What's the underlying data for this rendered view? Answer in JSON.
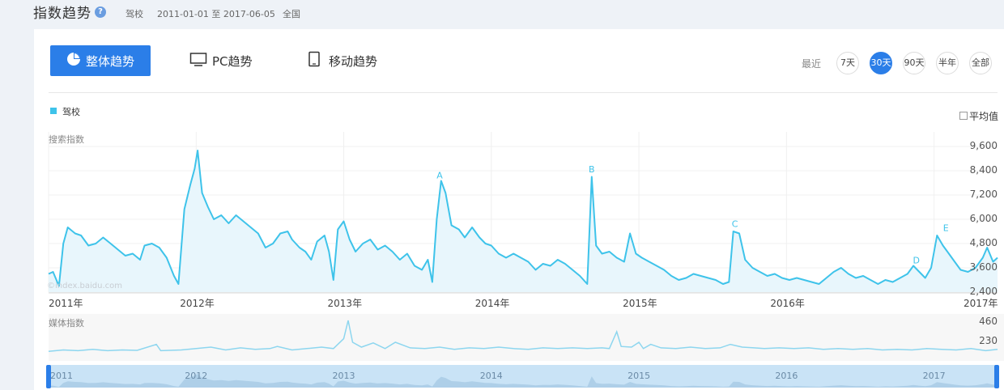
{
  "header": {
    "title": "指数趋势",
    "keyword": "驾校",
    "date_range": "2011-01-01 至 2017-06-05",
    "region": "全国"
  },
  "tabs": [
    {
      "label": "整体趋势",
      "icon": "pie-chart-icon",
      "active": true
    },
    {
      "label": "PC趋势",
      "icon": "monitor-icon",
      "active": false
    },
    {
      "label": "移动趋势",
      "icon": "tablet-icon",
      "active": false
    }
  ],
  "range": {
    "label": "最近",
    "options": [
      "7天",
      "30天",
      "90天",
      "半年",
      "全部"
    ],
    "selected": "30天"
  },
  "legend": {
    "series_name": "驾校",
    "color": "#3ec3ea"
  },
  "average_toggle": {
    "label": "平均值",
    "checked": false
  },
  "watermark": "©index.baidu.com",
  "colors": {
    "accent": "#2b7ee8",
    "series": "#3ec3ea",
    "media": "#8dd6ef"
  },
  "chart_data": [
    {
      "type": "area",
      "title": "搜索指数",
      "x_labels": [
        "2011年",
        "2012年",
        "2013年",
        "2014年",
        "2015年",
        "2016年",
        "2017年"
      ],
      "y_ticks": [
        "9,600",
        "8,400",
        "7,200",
        "6,000",
        "4,800",
        "3,600",
        "2,400"
      ],
      "ylim": [
        2400,
        9600
      ],
      "xlim": [
        2011.0,
        2017.43
      ],
      "annotations": [
        {
          "label": "A",
          "x": 2013.65,
          "y": 7900
        },
        {
          "label": "B",
          "x": 2014.68,
          "y": 8200
        },
        {
          "label": "C",
          "x": 2015.65,
          "y": 5500
        },
        {
          "label": "D",
          "x": 2016.88,
          "y": 3700
        },
        {
          "label": "E",
          "x": 2017.08,
          "y": 5300
        }
      ],
      "series": [
        {
          "name": "驾校",
          "points": [
            [
              2011.0,
              3300
            ],
            [
              2011.03,
              3400
            ],
            [
              2011.07,
              2700
            ],
            [
              2011.1,
              4800
            ],
            [
              2011.13,
              5600
            ],
            [
              2011.18,
              5300
            ],
            [
              2011.22,
              5200
            ],
            [
              2011.27,
              4700
            ],
            [
              2011.32,
              4800
            ],
            [
              2011.37,
              5100
            ],
            [
              2011.42,
              4800
            ],
            [
              2011.47,
              4500
            ],
            [
              2011.52,
              4200
            ],
            [
              2011.57,
              4300
            ],
            [
              2011.62,
              4000
            ],
            [
              2011.65,
              4700
            ],
            [
              2011.7,
              4800
            ],
            [
              2011.75,
              4600
            ],
            [
              2011.8,
              4100
            ],
            [
              2011.85,
              3200
            ],
            [
              2011.88,
              2800
            ],
            [
              2011.92,
              6500
            ],
            [
              2011.96,
              7700
            ],
            [
              2011.99,
              8500
            ],
            [
              2012.01,
              9400
            ],
            [
              2012.04,
              7300
            ],
            [
              2012.08,
              6600
            ],
            [
              2012.12,
              6000
            ],
            [
              2012.17,
              6200
            ],
            [
              2012.22,
              5800
            ],
            [
              2012.27,
              6200
            ],
            [
              2012.32,
              5900
            ],
            [
              2012.37,
              5600
            ],
            [
              2012.42,
              5300
            ],
            [
              2012.47,
              4600
            ],
            [
              2012.52,
              4800
            ],
            [
              2012.57,
              5300
            ],
            [
              2012.62,
              5400
            ],
            [
              2012.65,
              5000
            ],
            [
              2012.7,
              4600
            ],
            [
              2012.74,
              4400
            ],
            [
              2012.78,
              4000
            ],
            [
              2012.82,
              4900
            ],
            [
              2012.87,
              5200
            ],
            [
              2012.9,
              4400
            ],
            [
              2012.93,
              3000
            ],
            [
              2012.96,
              5500
            ],
            [
              2013.0,
              5900
            ],
            [
              2013.04,
              5000
            ],
            [
              2013.08,
              4400
            ],
            [
              2013.13,
              4800
            ],
            [
              2013.18,
              5000
            ],
            [
              2013.23,
              4500
            ],
            [
              2013.28,
              4700
            ],
            [
              2013.33,
              4400
            ],
            [
              2013.38,
              4000
            ],
            [
              2013.43,
              4300
            ],
            [
              2013.48,
              3700
            ],
            [
              2013.53,
              3500
            ],
            [
              2013.57,
              4000
            ],
            [
              2013.6,
              2900
            ],
            [
              2013.63,
              6000
            ],
            [
              2013.66,
              7900
            ],
            [
              2013.69,
              7300
            ],
            [
              2013.73,
              5700
            ],
            [
              2013.78,
              5500
            ],
            [
              2013.82,
              5100
            ],
            [
              2013.87,
              5600
            ],
            [
              2013.92,
              5100
            ],
            [
              2013.96,
              4800
            ],
            [
              2014.0,
              4700
            ],
            [
              2014.05,
              4300
            ],
            [
              2014.1,
              4100
            ],
            [
              2014.15,
              4300
            ],
            [
              2014.2,
              4100
            ],
            [
              2014.25,
              3900
            ],
            [
              2014.3,
              3500
            ],
            [
              2014.35,
              3800
            ],
            [
              2014.4,
              3700
            ],
            [
              2014.45,
              4000
            ],
            [
              2014.5,
              3800
            ],
            [
              2014.55,
              3500
            ],
            [
              2014.6,
              3200
            ],
            [
              2014.65,
              2800
            ],
            [
              2014.68,
              8100
            ],
            [
              2014.71,
              4700
            ],
            [
              2014.75,
              4300
            ],
            [
              2014.8,
              4400
            ],
            [
              2014.85,
              4100
            ],
            [
              2014.9,
              3900
            ],
            [
              2014.94,
              5300
            ],
            [
              2014.98,
              4300
            ],
            [
              2015.02,
              4100
            ],
            [
              2015.07,
              3900
            ],
            [
              2015.12,
              3700
            ],
            [
              2015.17,
              3500
            ],
            [
              2015.22,
              3200
            ],
            [
              2015.27,
              3000
            ],
            [
              2015.32,
              3100
            ],
            [
              2015.37,
              3300
            ],
            [
              2015.42,
              3200
            ],
            [
              2015.47,
              3100
            ],
            [
              2015.52,
              3000
            ],
            [
              2015.57,
              2800
            ],
            [
              2015.61,
              2900
            ],
            [
              2015.64,
              5400
            ],
            [
              2015.68,
              5300
            ],
            [
              2015.72,
              4000
            ],
            [
              2015.77,
              3600
            ],
            [
              2015.82,
              3400
            ],
            [
              2015.87,
              3200
            ],
            [
              2015.92,
              3300
            ],
            [
              2015.97,
              3100
            ],
            [
              2016.02,
              3000
            ],
            [
              2016.07,
              3100
            ],
            [
              2016.12,
              3000
            ],
            [
              2016.17,
              2900
            ],
            [
              2016.22,
              2800
            ],
            [
              2016.27,
              3100
            ],
            [
              2016.32,
              3400
            ],
            [
              2016.37,
              3600
            ],
            [
              2016.42,
              3300
            ],
            [
              2016.47,
              3100
            ],
            [
              2016.52,
              3200
            ],
            [
              2016.57,
              3000
            ],
            [
              2016.62,
              2800
            ],
            [
              2016.67,
              3000
            ],
            [
              2016.72,
              2900
            ],
            [
              2016.77,
              3100
            ],
            [
              2016.82,
              3300
            ],
            [
              2016.86,
              3700
            ],
            [
              2016.9,
              3400
            ],
            [
              2016.94,
              3100
            ],
            [
              2016.98,
              3600
            ],
            [
              2017.02,
              5200
            ],
            [
              2017.06,
              4700
            ],
            [
              2017.1,
              4300
            ],
            [
              2017.14,
              3900
            ],
            [
              2017.18,
              3500
            ],
            [
              2017.23,
              3400
            ],
            [
              2017.28,
              3600
            ],
            [
              2017.33,
              4100
            ],
            [
              2017.36,
              4600
            ],
            [
              2017.4,
              3900
            ],
            [
              2017.43,
              4100
            ]
          ]
        }
      ]
    },
    {
      "type": "area",
      "title": "媒体指数",
      "y_ticks": [
        "460",
        "230"
      ],
      "ylim": [
        0,
        460
      ],
      "xlim": [
        2011.0,
        2017.43
      ],
      "series": [
        {
          "name": "驾校",
          "points": [
            [
              2011.0,
              20
            ],
            [
              2011.1,
              40
            ],
            [
              2011.2,
              30
            ],
            [
              2011.3,
              50
            ],
            [
              2011.4,
              30
            ],
            [
              2011.5,
              40
            ],
            [
              2011.6,
              35
            ],
            [
              2011.73,
              120
            ],
            [
              2011.76,
              30
            ],
            [
              2011.9,
              40
            ],
            [
              2012.0,
              60
            ],
            [
              2012.1,
              80
            ],
            [
              2012.2,
              40
            ],
            [
              2012.3,
              70
            ],
            [
              2012.4,
              50
            ],
            [
              2012.5,
              60
            ],
            [
              2012.55,
              90
            ],
            [
              2012.65,
              40
            ],
            [
              2012.75,
              60
            ],
            [
              2012.85,
              80
            ],
            [
              2012.93,
              60
            ],
            [
              2013.0,
              200
            ],
            [
              2013.03,
              460
            ],
            [
              2013.06,
              150
            ],
            [
              2013.12,
              80
            ],
            [
              2013.2,
              140
            ],
            [
              2013.28,
              60
            ],
            [
              2013.35,
              150
            ],
            [
              2013.45,
              70
            ],
            [
              2013.55,
              60
            ],
            [
              2013.65,
              80
            ],
            [
              2013.75,
              50
            ],
            [
              2013.85,
              70
            ],
            [
              2013.95,
              60
            ],
            [
              2014.05,
              80
            ],
            [
              2014.15,
              60
            ],
            [
              2014.25,
              50
            ],
            [
              2014.35,
              70
            ],
            [
              2014.45,
              60
            ],
            [
              2014.55,
              70
            ],
            [
              2014.65,
              60
            ],
            [
              2014.75,
              70
            ],
            [
              2014.8,
              60
            ],
            [
              2014.85,
              300
            ],
            [
              2014.88,
              90
            ],
            [
              2014.95,
              80
            ],
            [
              2015.0,
              150
            ],
            [
              2015.03,
              60
            ],
            [
              2015.08,
              120
            ],
            [
              2015.15,
              70
            ],
            [
              2015.25,
              60
            ],
            [
              2015.35,
              80
            ],
            [
              2015.45,
              60
            ],
            [
              2015.55,
              70
            ],
            [
              2015.62,
              120
            ],
            [
              2015.7,
              80
            ],
            [
              2015.78,
              70
            ],
            [
              2015.85,
              60
            ],
            [
              2015.95,
              70
            ],
            [
              2016.05,
              60
            ],
            [
              2016.15,
              70
            ],
            [
              2016.25,
              50
            ],
            [
              2016.35,
              60
            ],
            [
              2016.45,
              50
            ],
            [
              2016.55,
              60
            ],
            [
              2016.65,
              40
            ],
            [
              2016.75,
              50
            ],
            [
              2016.85,
              40
            ],
            [
              2016.95,
              60
            ],
            [
              2017.05,
              50
            ],
            [
              2017.15,
              40
            ],
            [
              2017.25,
              60
            ],
            [
              2017.35,
              30
            ],
            [
              2017.43,
              50
            ]
          ]
        }
      ]
    }
  ],
  "navigator": {
    "x_labels": [
      "2011",
      "2012",
      "2013",
      "2014",
      "2015",
      "2016",
      "2017"
    ]
  }
}
